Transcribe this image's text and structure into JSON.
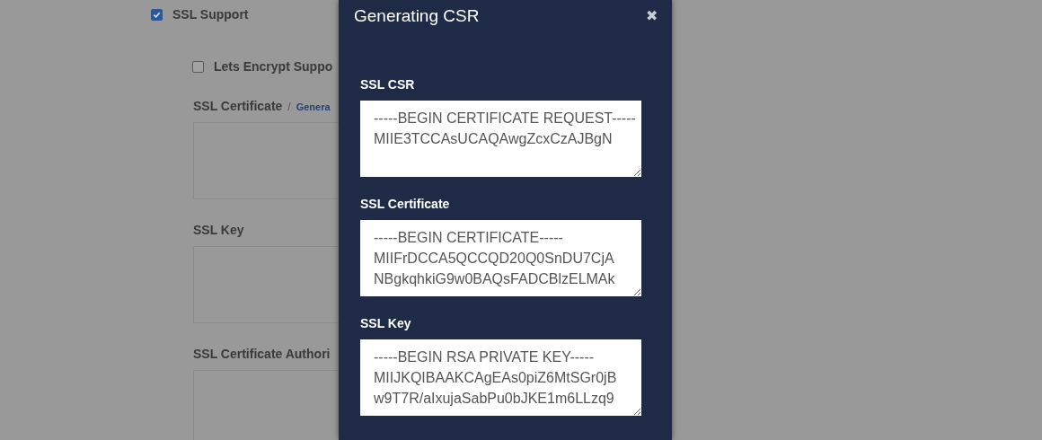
{
  "background_form": {
    "ssl_support": {
      "label": "SSL Support",
      "checked": true
    },
    "lets_encrypt": {
      "label": "Lets Encrypt Suppo",
      "checked": false
    },
    "fields": [
      {
        "label": "SSL Certificate",
        "separator": "/",
        "link": "Genera"
      },
      {
        "label": "SSL Key"
      },
      {
        "label": "SSL Certificate Authori"
      }
    ]
  },
  "modal": {
    "title": "Generating CSR",
    "close": "✖",
    "fields": [
      {
        "label": "SSL CSR",
        "value": "-----BEGIN CERTIFICATE REQUEST-----\nMIIE3TCCAsUCAQAwgZcxCzAJBgN"
      },
      {
        "label": "SSL Certificate",
        "value": "-----BEGIN CERTIFICATE-----\nMIIFrDCCA5QCCQD20Q0SnDU7CjA\nNBgkqhkiG9w0BAQsFADCBlzELMAk"
      },
      {
        "label": "SSL Key",
        "value": "-----BEGIN RSA PRIVATE KEY-----\nMIIJKQIBAAKCAgEAs0piZ6MtSGr0jB\nw9T7R/aIxujaSabPu0bJKE1m6LLzq9"
      }
    ]
  }
}
